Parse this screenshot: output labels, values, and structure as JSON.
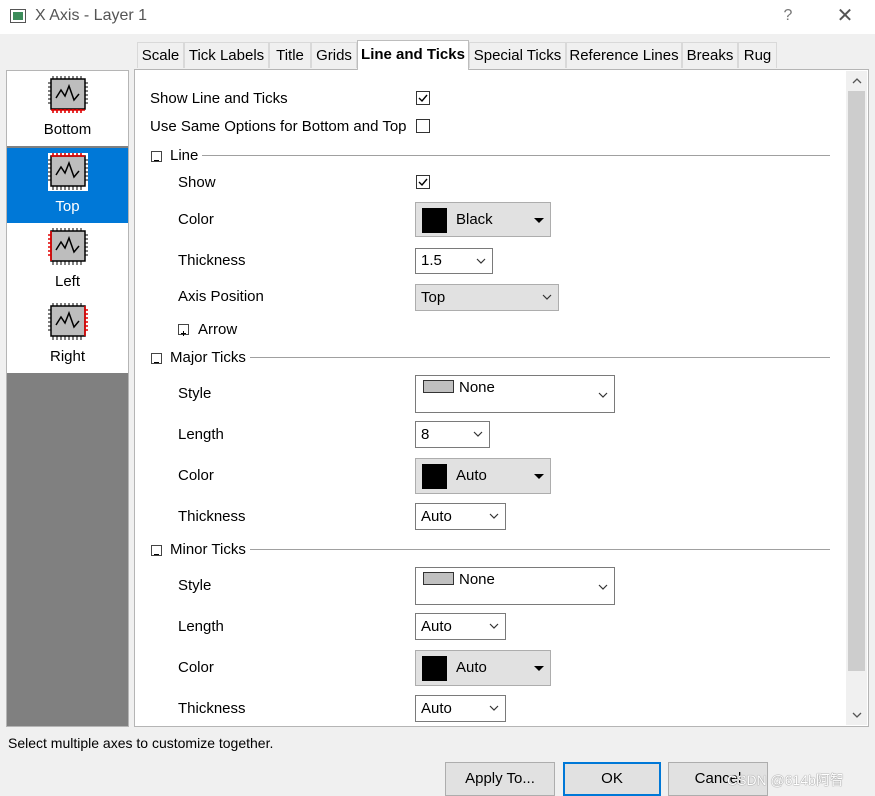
{
  "window": {
    "title": "X Axis - Layer 1",
    "help": "?",
    "close": "✕"
  },
  "tabs": [
    {
      "label": "Scale"
    },
    {
      "label": "Tick Labels"
    },
    {
      "label": "Title"
    },
    {
      "label": "Grids"
    },
    {
      "label": "Line and Ticks",
      "active": true
    },
    {
      "label": "Special Ticks"
    },
    {
      "label": "Reference Lines"
    },
    {
      "label": "Breaks"
    },
    {
      "label": "Rug"
    }
  ],
  "axes": [
    {
      "label": "Bottom"
    },
    {
      "label": "Top",
      "selected": true
    },
    {
      "label": "Left"
    },
    {
      "label": "Right"
    }
  ],
  "general": {
    "show_line_ticks_label": "Show Line and Ticks",
    "show_line_ticks_checked": true,
    "same_options_label": "Use Same Options for Bottom and Top",
    "same_options_checked": false
  },
  "line": {
    "header": "Line",
    "show_label": "Show",
    "show_checked": true,
    "color_label": "Color",
    "color_value": "Black",
    "thickness_label": "Thickness",
    "thickness_value": "1.5",
    "position_label": "Axis Position",
    "position_value": "Top",
    "arrow_label": "Arrow"
  },
  "major": {
    "header": "Major Ticks",
    "style_label": "Style",
    "style_value": "None",
    "length_label": "Length",
    "length_value": "8",
    "color_label": "Color",
    "color_value": "Auto",
    "thickness_label": "Thickness",
    "thickness_value": "Auto"
  },
  "minor": {
    "header": "Minor Ticks",
    "style_label": "Style",
    "style_value": "None",
    "length_label": "Length",
    "length_value": "Auto",
    "color_label": "Color",
    "color_value": "Auto",
    "thickness_label": "Thickness",
    "thickness_value": "Auto"
  },
  "status": "Select multiple axes to customize together.",
  "buttons": {
    "apply": "Apply To...",
    "ok": "OK",
    "cancel": "Cancel"
  },
  "watermark": "CSDN @614b阿智",
  "colors": {
    "accent": "#0078d7",
    "list_bg": "#808080",
    "selected_bg": "#0078d7"
  }
}
